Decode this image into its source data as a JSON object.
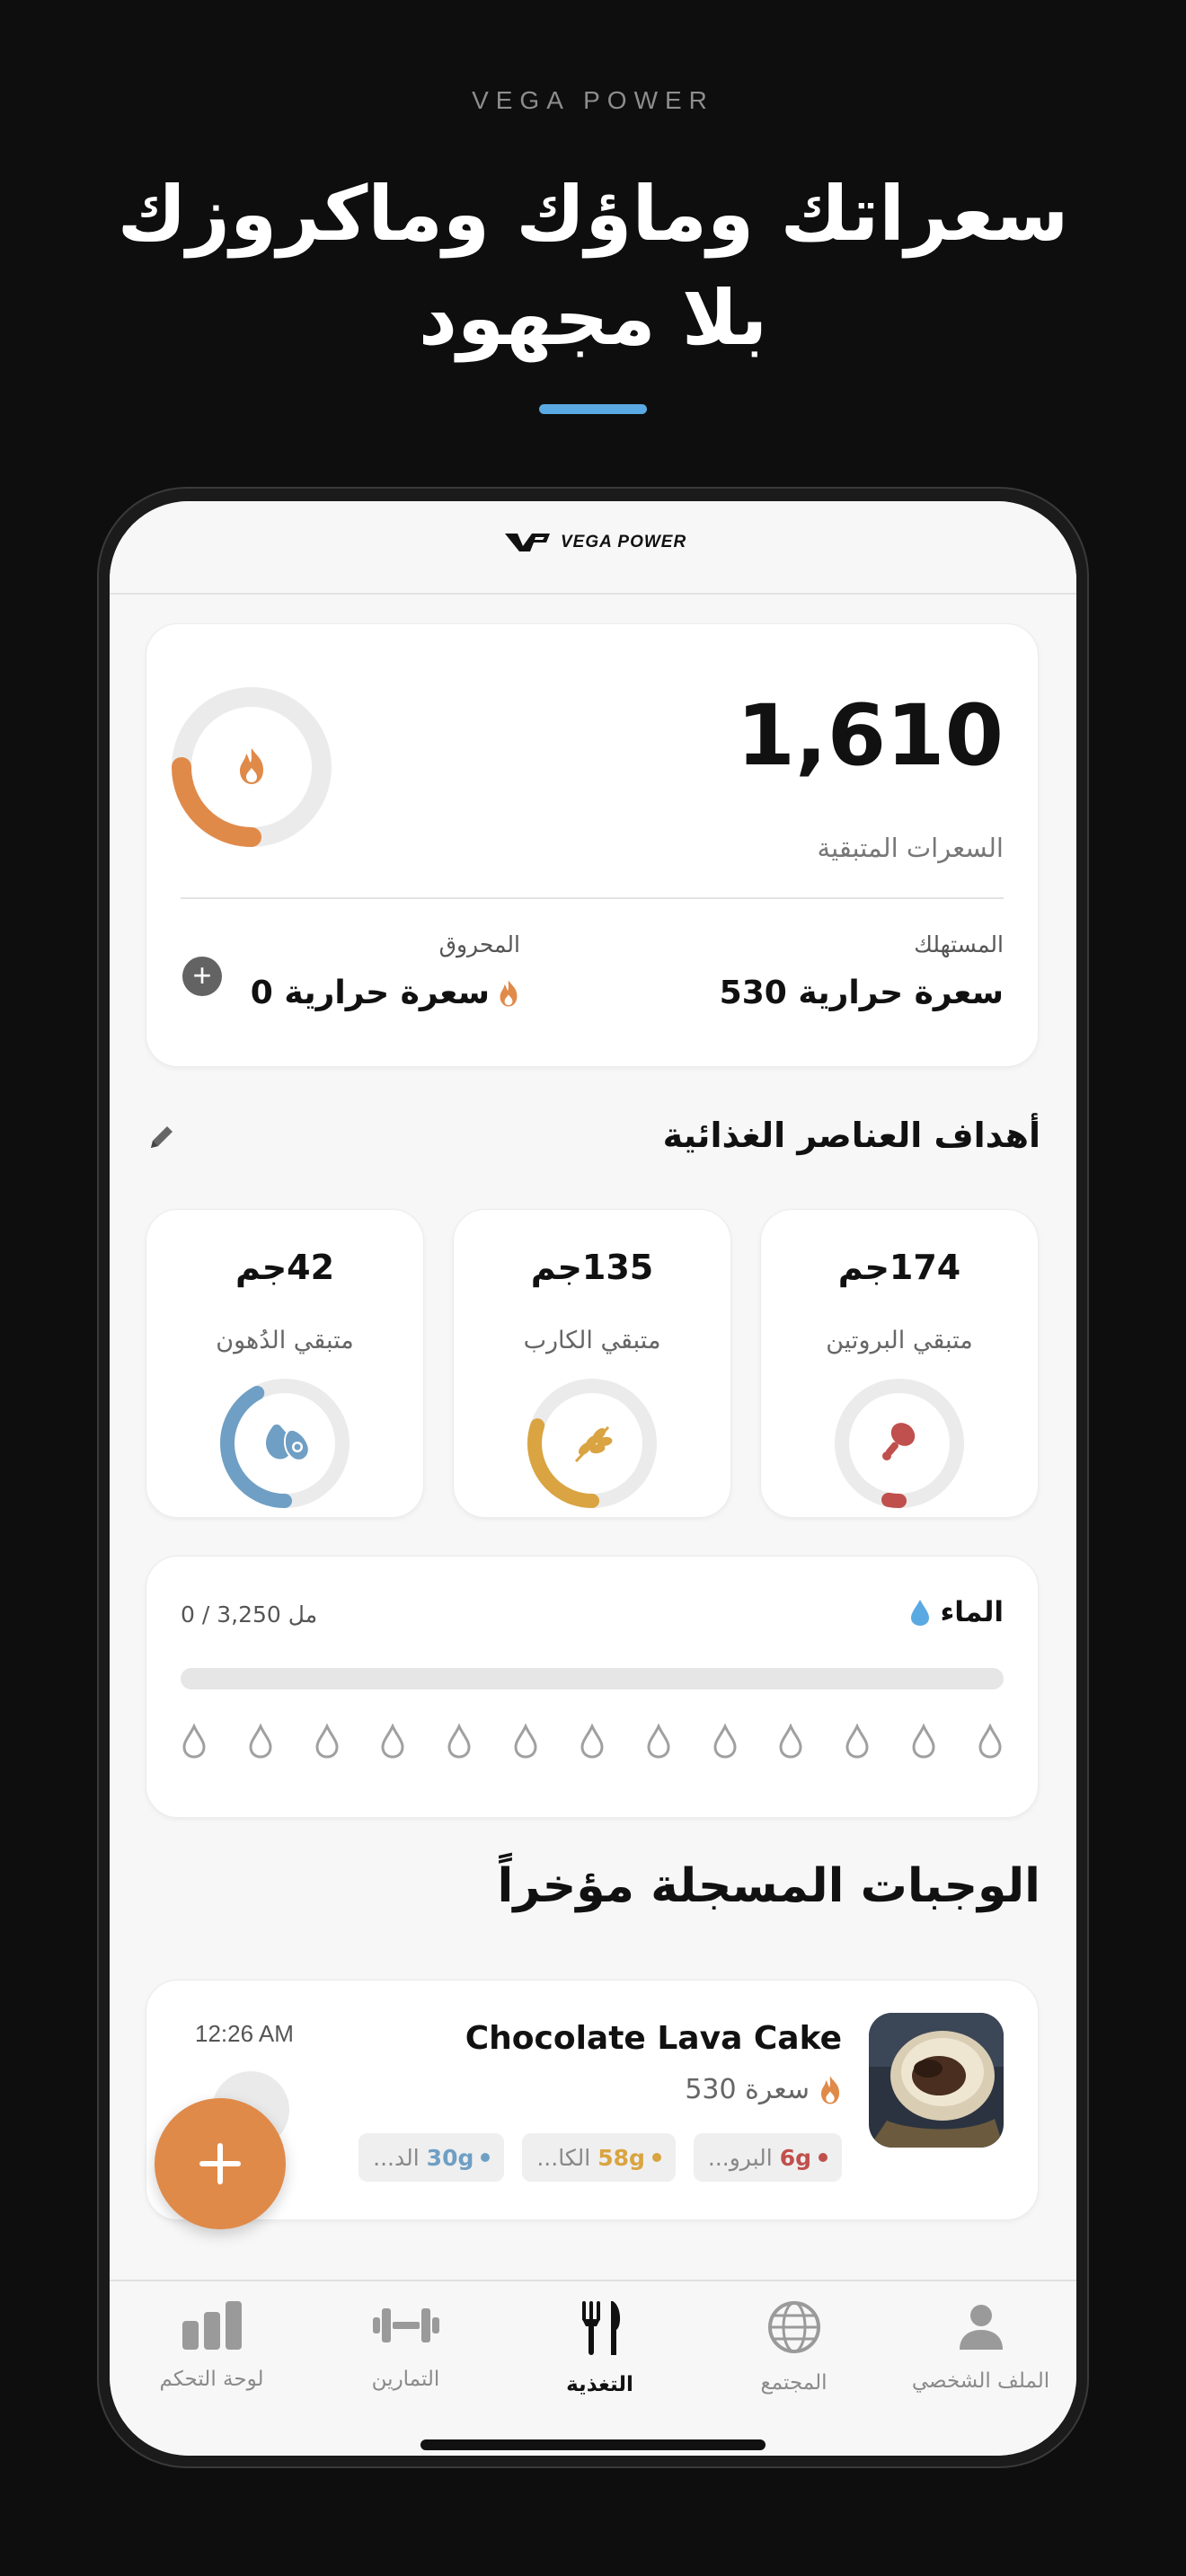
{
  "promo": {
    "brand": "VEGA POWER",
    "headline_line1": "سعراتك وماؤك وماكروزك",
    "headline_line2": "بلا مجهود"
  },
  "app": {
    "logo_text": "VEGA POWER"
  },
  "calories": {
    "remaining_value": "1,610",
    "remaining_label": "السعرات المتبقية",
    "consumed_label": "المستهلك",
    "consumed_value": "سعرة حرارية 530",
    "burned_label": "المحروق",
    "burned_value": "سعرة حرارية 0",
    "consumed_fraction": 0.25,
    "ring_color": "#e08a4a"
  },
  "nutrients": {
    "title": "أهداف العناصر الغذائية",
    "items": [
      {
        "value": "174جم",
        "label": "متبقي البروتين",
        "color": "#c0504d",
        "icon": "drumstick-icon",
        "progress": 0.03
      },
      {
        "value": "135جم",
        "label": "متبقي الكارب",
        "color": "#d9a441",
        "icon": "wheat-icon",
        "progress": 0.3
      },
      {
        "value": "42جم",
        "label": "متبقي الدُهون",
        "color": "#6f9fc4",
        "icon": "avocado-icon",
        "progress": 0.42
      }
    ]
  },
  "water": {
    "title": "الماء",
    "count": "مل 3,250 / 0",
    "progress": 0,
    "drops": 13,
    "color": "#5aa9e2"
  },
  "recent_meals": {
    "title": "الوجبات المسجلة مؤخراً",
    "items": [
      {
        "name": "Chocolate Lava Cake",
        "calories": "سعرة 530",
        "time": "12:26 AM",
        "chips": [
          {
            "amount": "6g",
            "label": "البرو...",
            "color": "#c0504d"
          },
          {
            "amount": "58g",
            "label": "الكا...",
            "color": "#d9a441"
          },
          {
            "amount": "30g",
            "label": "الد...",
            "color": "#6f9fc4"
          }
        ]
      }
    ]
  },
  "fab": {
    "label": "+"
  },
  "tabs": [
    {
      "label": "لوحة التحكم",
      "icon": "dashboard-icon",
      "active": false
    },
    {
      "label": "التمارين",
      "icon": "dumbbell-icon",
      "active": false
    },
    {
      "label": "التغذية",
      "icon": "fork-knife-icon",
      "active": true
    },
    {
      "label": "المجتمع",
      "icon": "globe-icon",
      "active": false
    },
    {
      "label": "الملف الشخصي",
      "icon": "profile-icon",
      "active": false
    }
  ]
}
